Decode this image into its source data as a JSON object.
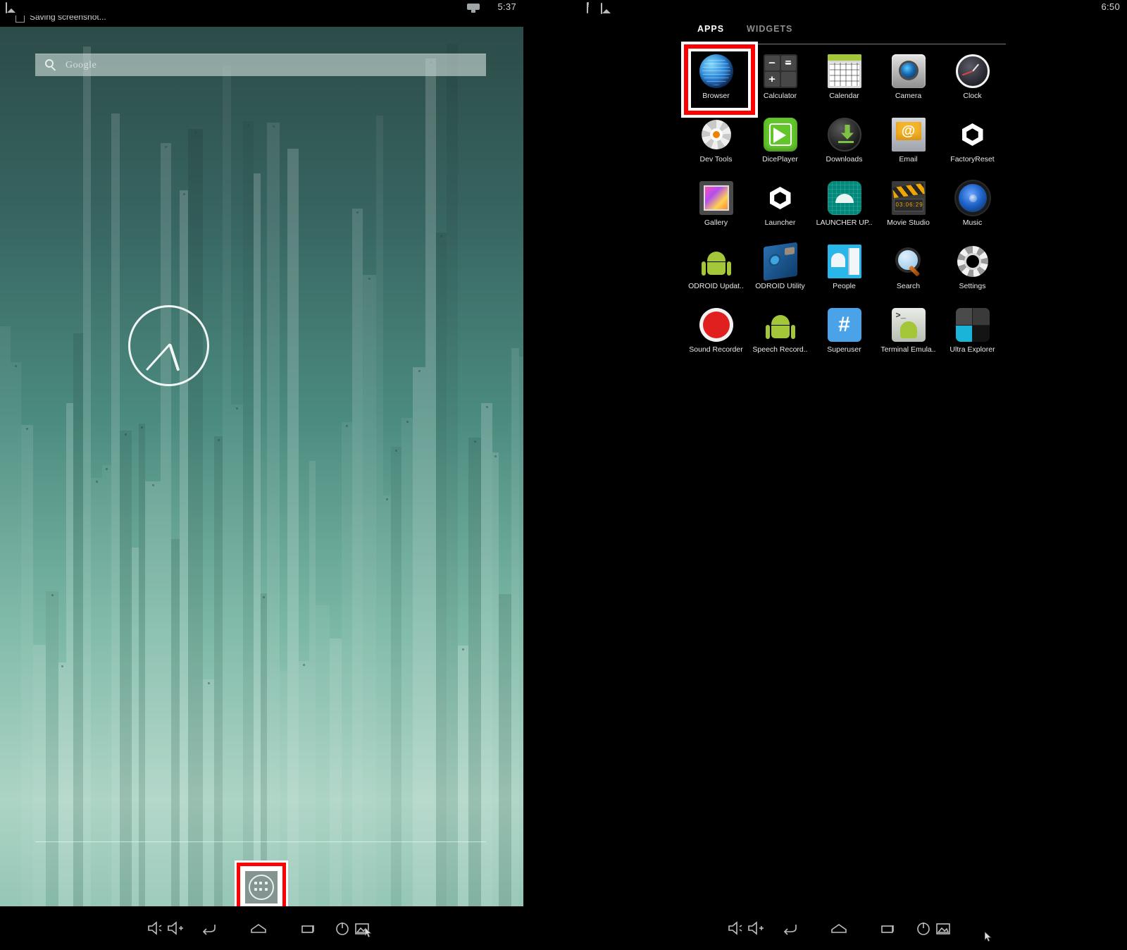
{
  "left_panel": {
    "status_bar": {
      "time": "5:37",
      "usb_icon": "usb-connected-icon"
    },
    "notification": {
      "icon": "screenshot-icon",
      "text": "Saving screenshot..."
    },
    "search": {
      "placeholder": "Google",
      "icon": "search-icon"
    },
    "clock_widget": {
      "name": "analog-clock-widget",
      "time": "5:37"
    },
    "app_drawer_button": {
      "label": "All Apps",
      "icon": "apps-grid-icon",
      "highlighted": true
    },
    "highlight_color": "#ff0000"
  },
  "right_panel": {
    "status_bar": {
      "time": "6:50",
      "icons": [
        "sd-card-warning-icon",
        "screenshot-image-icon"
      ]
    },
    "tabs": [
      {
        "label": "APPS",
        "active": true
      },
      {
        "label": "WIDGETS",
        "active": false
      }
    ],
    "highlight_color": "#ff0000",
    "apps": [
      {
        "label": "Browser",
        "icon": "browser-globe-icon",
        "highlighted": true
      },
      {
        "label": "Calculator",
        "icon": "calculator-icon",
        "highlighted": false
      },
      {
        "label": "Calendar",
        "icon": "calendar-icon",
        "highlighted": false
      },
      {
        "label": "Camera",
        "icon": "camera-icon",
        "highlighted": false
      },
      {
        "label": "Clock",
        "icon": "clock-icon",
        "highlighted": false
      },
      {
        "label": "Dev Tools",
        "icon": "dev-tools-gear-icon",
        "highlighted": false
      },
      {
        "label": "DicePlayer",
        "icon": "diceplayer-icon",
        "highlighted": false
      },
      {
        "label": "Downloads",
        "icon": "downloads-icon",
        "highlighted": false
      },
      {
        "label": "Email",
        "icon": "email-icon",
        "highlighted": false
      },
      {
        "label": "FactoryReset",
        "icon": "unity-logo-icon",
        "highlighted": false
      },
      {
        "label": "Gallery",
        "icon": "gallery-icon",
        "highlighted": false
      },
      {
        "label": "Launcher",
        "icon": "unity-logo-icon",
        "highlighted": false
      },
      {
        "label": "LAUNCHER UP..",
        "icon": "launcher-update-icon",
        "highlighted": false
      },
      {
        "label": "Movie Studio",
        "icon": "movie-studio-icon",
        "highlighted": false
      },
      {
        "label": "Music",
        "icon": "music-icon",
        "highlighted": false
      },
      {
        "label": "ODROID Updat..",
        "icon": "android-box-icon",
        "highlighted": false
      },
      {
        "label": "ODROID Utility",
        "icon": "odroid-board-icon",
        "highlighted": false
      },
      {
        "label": "People",
        "icon": "people-icon",
        "highlighted": false
      },
      {
        "label": "Search",
        "icon": "search-magnifier-icon",
        "highlighted": false
      },
      {
        "label": "Settings",
        "icon": "settings-gear-icon",
        "highlighted": false
      },
      {
        "label": "Sound Recorder",
        "icon": "sound-recorder-icon",
        "highlighted": false
      },
      {
        "label": "Speech Record..",
        "icon": "android-icon",
        "highlighted": false
      },
      {
        "label": "Superuser",
        "icon": "superuser-hash-icon",
        "highlighted": false
      },
      {
        "label": "Terminal Emula..",
        "icon": "terminal-emulator-icon",
        "highlighted": false
      },
      {
        "label": "Ultra Explorer",
        "icon": "ultra-explorer-icon",
        "highlighted": false
      }
    ]
  },
  "nav_bar": {
    "buttons": [
      {
        "name": "volume-down-button",
        "icon": "volume-down-icon"
      },
      {
        "name": "volume-up-button",
        "icon": "volume-up-icon"
      },
      {
        "name": "back-button",
        "icon": "back-arrow-icon"
      },
      {
        "name": "home-button",
        "icon": "home-icon"
      },
      {
        "name": "recents-button",
        "icon": "recents-icon"
      },
      {
        "name": "power-button",
        "icon": "power-icon"
      },
      {
        "name": "screenshot-button",
        "icon": "screenshot-icon"
      }
    ]
  }
}
